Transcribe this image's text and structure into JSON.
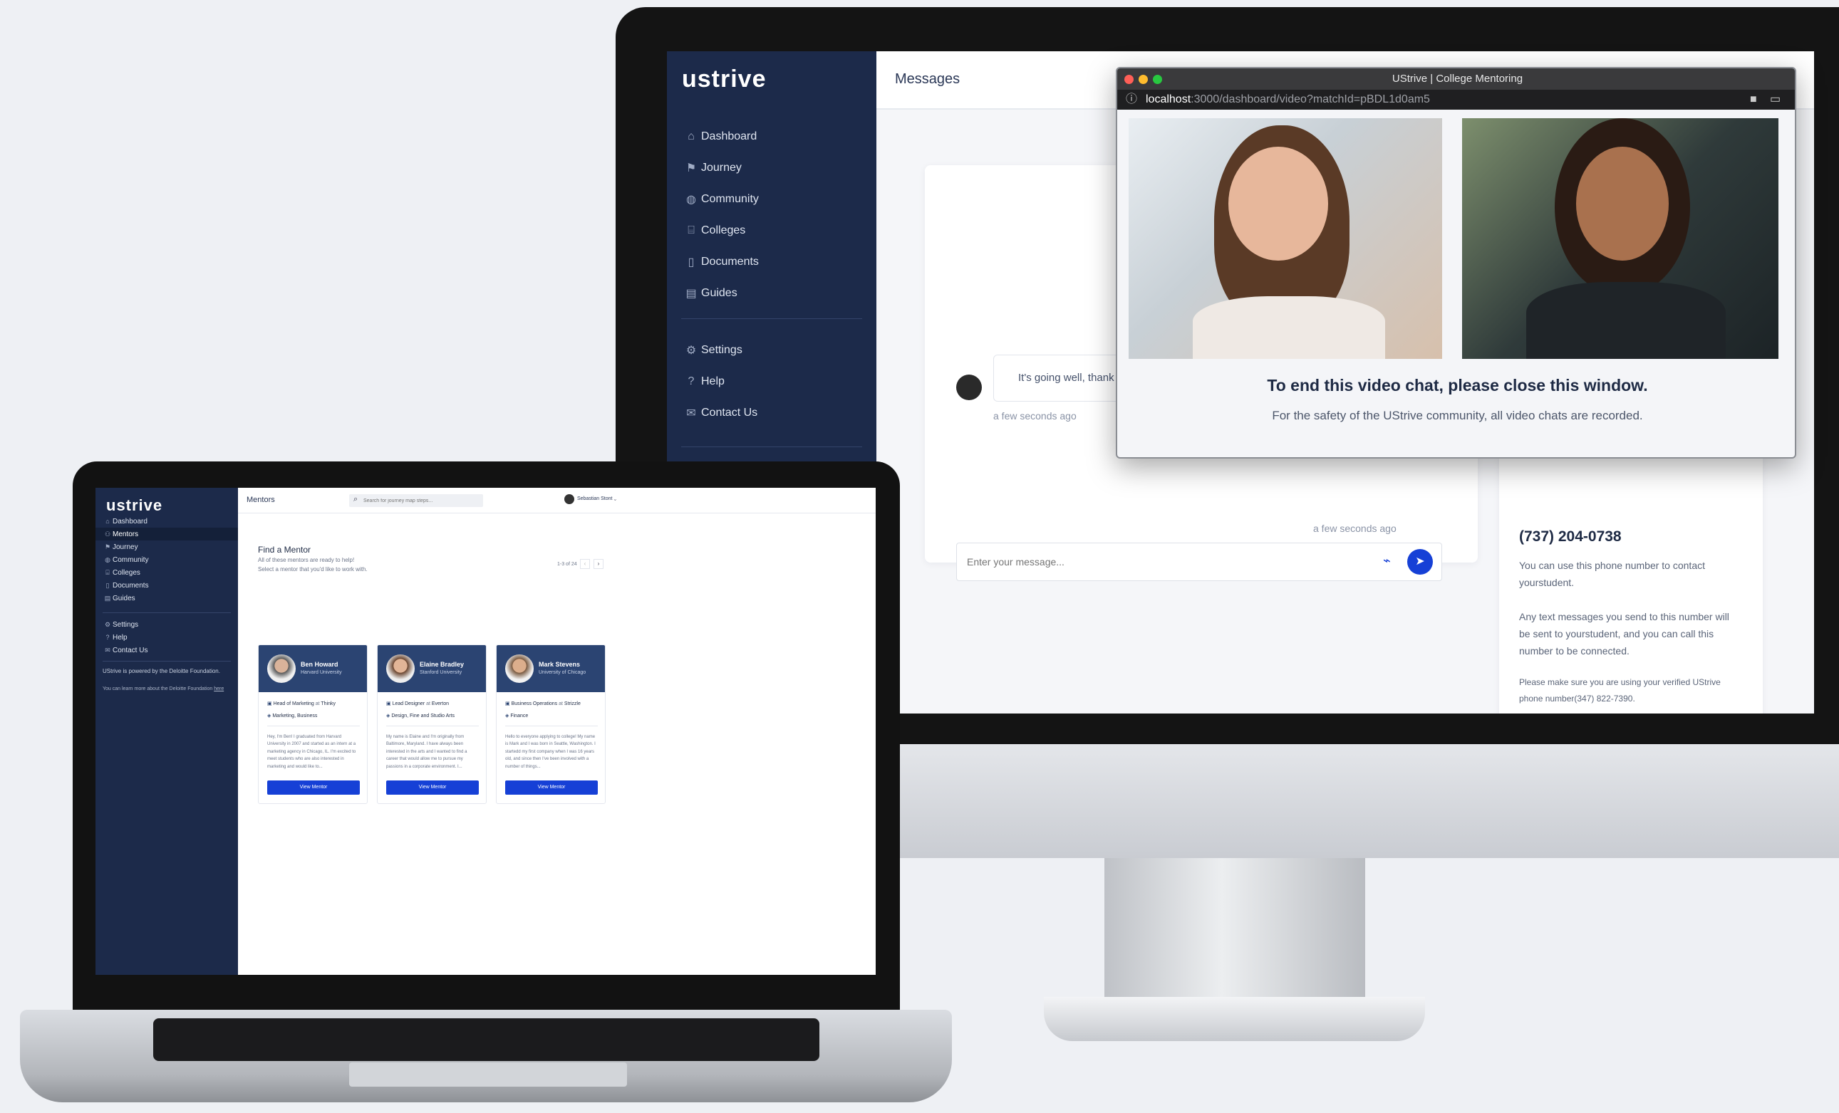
{
  "imac": {
    "logo": "ustrive",
    "sidebar": {
      "nav": [
        {
          "label": "Dashboard",
          "icon": "home-icon"
        },
        {
          "label": "Journey",
          "icon": "flag-icon"
        },
        {
          "label": "Community",
          "icon": "globe-icon"
        },
        {
          "label": "Colleges",
          "icon": "bank-icon"
        },
        {
          "label": "Documents",
          "icon": "document-icon"
        },
        {
          "label": "Guides",
          "icon": "book-icon"
        }
      ],
      "secondary": [
        {
          "label": "Settings",
          "icon": "gear-icon"
        },
        {
          "label": "Help",
          "icon": "help-icon"
        },
        {
          "label": "Contact Us",
          "icon": "mail-icon"
        }
      ]
    },
    "page_title": "Messages",
    "chat": {
      "message_1": "It's going well, thank",
      "time_1": "a few seconds ago",
      "time_2": "a few seconds ago",
      "input_placeholder": "Enter your message..."
    },
    "phone_card": {
      "number": "(737) 204-0738",
      "p1": "You can use this phone number to contact yourstudent.",
      "p2": "Any text messages you send to this number will be sent to yourstudent, and you can call this number to be connected.",
      "p3": "Please make sure you are using your verified UStrive phone number(347) 822-7390."
    },
    "video_window": {
      "title": "UStrive | College Mentoring",
      "url_host": "localhost",
      "url_path": ":3000/dashboard/video?matchId=pBDL1d0am5",
      "heading": "To end this video chat, please close this window.",
      "subtext": "For the safety of the UStrive community, all video chats are recorded."
    }
  },
  "laptop": {
    "logo": "ustrive",
    "topbar": {
      "title": "Mentors",
      "search_placeholder": "Search for journey map steps...",
      "user_name": "Sebastian Stont"
    },
    "sidebar": {
      "nav": [
        {
          "label": "Dashboard",
          "icon": "home-icon"
        },
        {
          "label": "Mentors",
          "icon": "users-icon"
        },
        {
          "label": "Journey",
          "icon": "flag-icon"
        },
        {
          "label": "Community",
          "icon": "globe-icon"
        },
        {
          "label": "Colleges",
          "icon": "bank-icon"
        },
        {
          "label": "Documents",
          "icon": "document-icon"
        },
        {
          "label": "Guides",
          "icon": "book-icon"
        }
      ],
      "secondary": [
        {
          "label": "Settings",
          "icon": "gear-icon"
        },
        {
          "label": "Help",
          "icon": "help-icon"
        },
        {
          "label": "Contact Us",
          "icon": "mail-icon"
        }
      ],
      "footer_1": "UStrive is powered by the Deloitte Foundation.",
      "footer_2": "You can learn more about the Deloitte Foundation",
      "footer_link": "here"
    },
    "main": {
      "heading": "Find a Mentor",
      "sub1": "All of these mentors are ready to help!",
      "sub2": "Select a mentor that you'd like to work with.",
      "pagination": "1-3 of 24",
      "mentors": [
        {
          "name": "Ben Howard",
          "school": "Harvard University",
          "role": "Head of Marketing",
          "at": "at",
          "company": "Thinky",
          "tags": "Marketing, Business",
          "bio": "Hey, I'm Ben! I graduated from Harvard University in 2007 and started as an intern at a marketing agency in Chicago, IL. I'm excited to meet students who are also interested in marketing and would like to...",
          "button": "View Mentor"
        },
        {
          "name": "Elaine Bradley",
          "school": "Stanford University",
          "role": "Lead Designer",
          "at": "at",
          "company": "Everton",
          "tags": "Design, Fine and Studio Arts",
          "bio": "My name is Elaine and I'm originally from Baltimore, Maryland. I have always been interested in the arts and I wanted to find a career that would allow me to pursue my passions in a corporate environment. I...",
          "button": "View Mentor"
        },
        {
          "name": "Mark Stevens",
          "school": "University of Chicago",
          "role": "Business Operations",
          "at": "at",
          "company": "Strizzle",
          "tags": "Finance",
          "bio": "Hello to everyone applying to college! My name is Mark and I was born in Seattle, Washington. I startedd my first company when I was 16 years old, and since then I've been involved with a number of things...",
          "button": "View Mentor"
        }
      ]
    }
  },
  "colors": {
    "navy": "#1c2a4a",
    "accent_blue": "#1640d6",
    "card_header": "#2b4472"
  }
}
